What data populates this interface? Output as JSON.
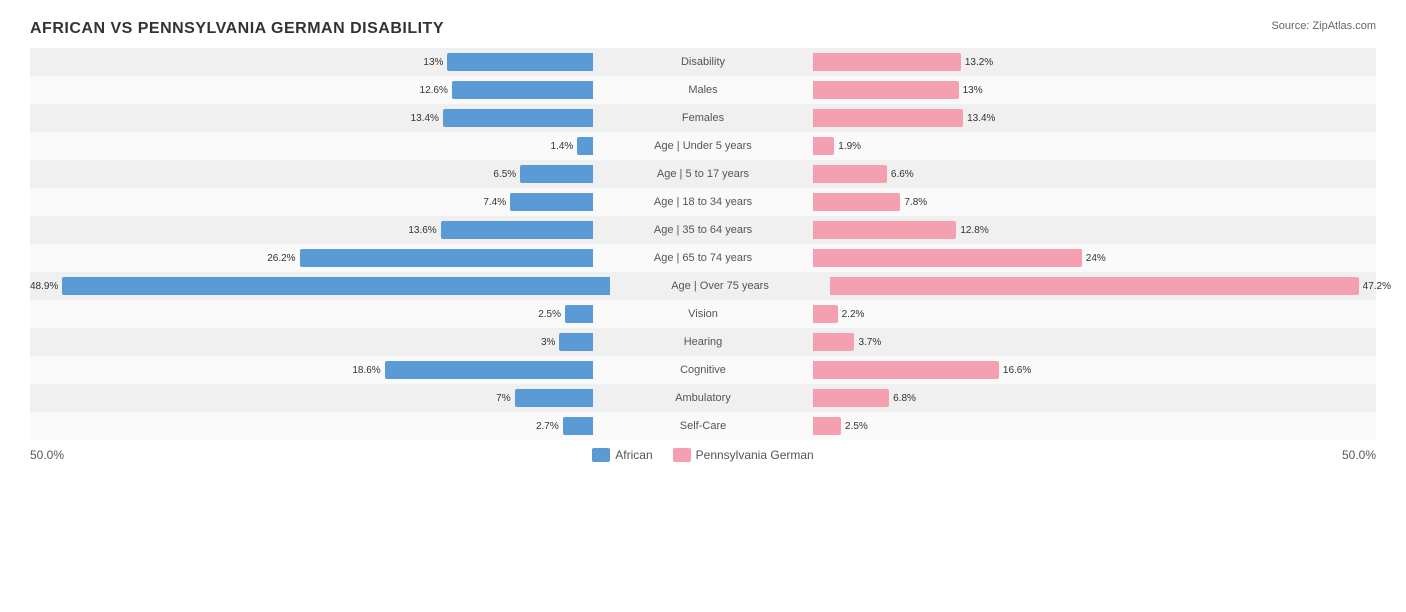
{
  "title": "AFRICAN VS PENNSYLVANIA GERMAN DISABILITY",
  "source": "Source: ZipAtlas.com",
  "scale_max": 50,
  "footer_left": "50.0%",
  "footer_right": "50.0%",
  "legend": {
    "african_label": "African",
    "pg_label": "Pennsylvania German"
  },
  "rows": [
    {
      "label": "Disability",
      "african": 13.0,
      "pg": 13.2
    },
    {
      "label": "Males",
      "african": 12.6,
      "pg": 13.0
    },
    {
      "label": "Females",
      "african": 13.4,
      "pg": 13.4
    },
    {
      "label": "Age | Under 5 years",
      "african": 1.4,
      "pg": 1.9
    },
    {
      "label": "Age | 5 to 17 years",
      "african": 6.5,
      "pg": 6.6
    },
    {
      "label": "Age | 18 to 34 years",
      "african": 7.4,
      "pg": 7.8
    },
    {
      "label": "Age | 35 to 64 years",
      "african": 13.6,
      "pg": 12.8
    },
    {
      "label": "Age | 65 to 74 years",
      "african": 26.2,
      "pg": 24.0
    },
    {
      "label": "Age | Over 75 years",
      "african": 48.9,
      "pg": 47.2
    },
    {
      "label": "Vision",
      "african": 2.5,
      "pg": 2.2
    },
    {
      "label": "Hearing",
      "african": 3.0,
      "pg": 3.7
    },
    {
      "label": "Cognitive",
      "african": 18.6,
      "pg": 16.6
    },
    {
      "label": "Ambulatory",
      "african": 7.0,
      "pg": 6.8
    },
    {
      "label": "Self-Care",
      "african": 2.7,
      "pg": 2.5
    }
  ]
}
